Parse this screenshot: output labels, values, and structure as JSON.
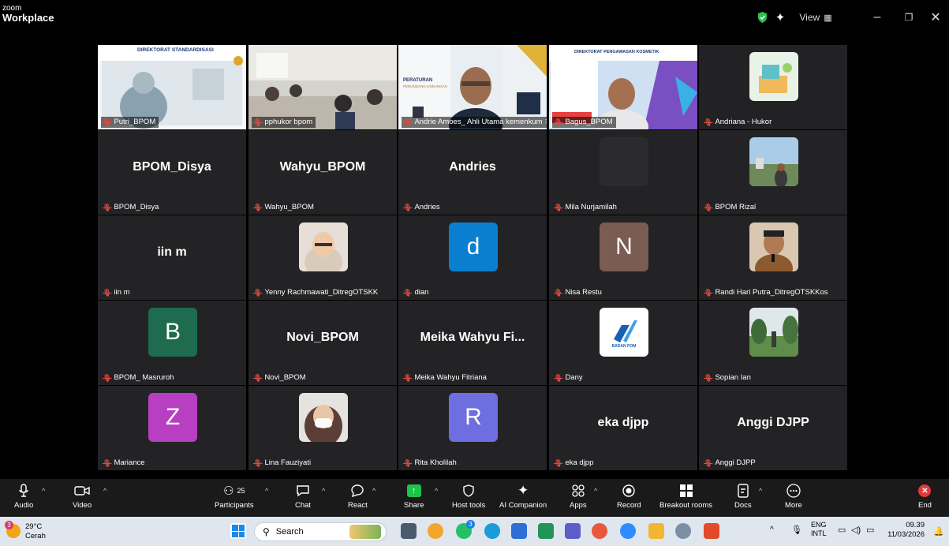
{
  "app": {
    "brand_line1": "zoom",
    "brand_line2": "Workplace",
    "view_label": "View"
  },
  "participants": [
    {
      "name": "Putri_BPOM",
      "kind": "video",
      "variant": "slide-lady"
    },
    {
      "name": "pphukor bpom",
      "kind": "video",
      "variant": "room"
    },
    {
      "name": "Andrie Amoes_ Ahli Utama kemenkum",
      "kind": "video",
      "variant": "speaker",
      "active": true
    },
    {
      "name": "Bagus_BPOM",
      "kind": "video",
      "variant": "slide-man"
    },
    {
      "name": "Andriana - Hukor",
      "kind": "photo",
      "variant": "illus"
    },
    {
      "name": "BPOM_Disya",
      "kind": "text",
      "display": "BPOM_Disya"
    },
    {
      "name": "Wahyu_BPOM",
      "kind": "text",
      "display": "Wahyu_BPOM"
    },
    {
      "name": "Andries",
      "kind": "text",
      "display": "Andries"
    },
    {
      "name": "Mila Nurjamilah",
      "kind": "photo",
      "variant": "dark"
    },
    {
      "name": "BPOM Rizal",
      "kind": "photo",
      "variant": "landscape"
    },
    {
      "name": "iin m",
      "kind": "text",
      "display": "iin m"
    },
    {
      "name": "Yenny Rachmawati_DitregOTSKK",
      "kind": "photo",
      "variant": "hijab-glasses"
    },
    {
      "name": "dian",
      "kind": "letter",
      "letter": "d",
      "color": "#0a7fd0"
    },
    {
      "name": "Nisa Restu",
      "kind": "letter",
      "letter": "N",
      "color": "#7a5c52"
    },
    {
      "name": "Randi Hari Putra_DitregOTSKKos",
      "kind": "photo",
      "variant": "man-mic"
    },
    {
      "name": "BPOM_ Masruroh",
      "kind": "letter",
      "letter": "B",
      "color": "#1e6b4f"
    },
    {
      "name": "Novi_BPOM",
      "kind": "text",
      "display": "Novi_BPOM"
    },
    {
      "name": "Meika Wahyu Fitriana",
      "kind": "text",
      "display": "Meika Wahyu Fi..."
    },
    {
      "name": "Dany",
      "kind": "photo",
      "variant": "logo"
    },
    {
      "name": "Sopian Ian",
      "kind": "photo",
      "variant": "outdoor"
    },
    {
      "name": "Mariance",
      "kind": "letter",
      "letter": "Z",
      "color": "#b93fc2"
    },
    {
      "name": "Lina Fauziyati",
      "kind": "photo",
      "variant": "hijab-mask"
    },
    {
      "name": "Rita Kholilah",
      "kind": "letter",
      "letter": "R",
      "color": "#6e6ee0"
    },
    {
      "name": "eka djpp",
      "kind": "text",
      "display": "eka djpp"
    },
    {
      "name": "Anggi DJPP",
      "kind": "text",
      "display": "Anggi DJPP"
    }
  ],
  "slides": {
    "dir_standardisasi": "DIREKTORAT STANDARDISASI",
    "peraturan": "PERATURAN",
    "perundang": "PERUNDANG-UNDANGAN",
    "dir_kosmetik": "DIREKTORAT PENGAWASAN KOSMETIK",
    "badan_pom": "BADAN POM"
  },
  "toolbar": {
    "audio": "Audio",
    "video": "Video",
    "participants": "Participants",
    "participants_count": "25",
    "chat": "Chat",
    "react": "React",
    "share": "Share",
    "host_tools": "Host tools",
    "ai_companion": "AI Companion",
    "apps": "Apps",
    "record": "Record",
    "breakout_rooms": "Breakout rooms",
    "docs": "Docs",
    "more": "More",
    "end": "End"
  },
  "taskbar": {
    "weather_temp": "29°C",
    "weather_desc": "Cerah",
    "weather_badge": "3",
    "search_placeholder": "Search",
    "whatsapp_badge": "3",
    "lang1": "ENG",
    "lang2": "INTL",
    "time": "09.39",
    "date": "11/03/2026"
  }
}
